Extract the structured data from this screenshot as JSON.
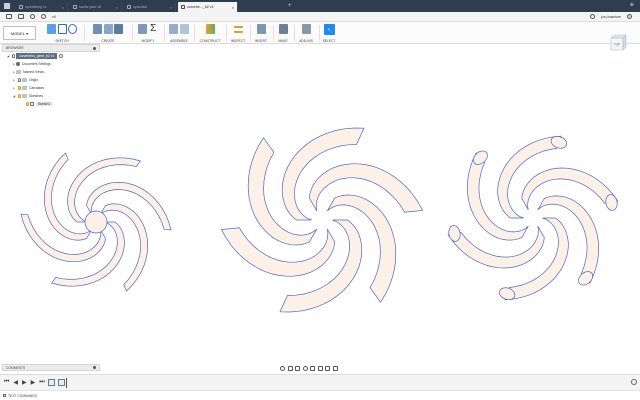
{
  "window": {
    "tabs": [
      {
        "label": "cycoidbing v1",
        "active": false
      },
      {
        "label": "savior.yuto v8",
        "active": false
      },
      {
        "label": "cycloidal",
        "active": false
      },
      {
        "label": "curvehe..._b2 v1",
        "active": true
      }
    ],
    "user": "jon.trawtom",
    "help": "?"
  },
  "quickbar": {
    "doc_label": "e8"
  },
  "ribbon": {
    "mode": "MODEL",
    "groups": [
      "SKETCH",
      "CREATE",
      "MODIFY",
      "ASSEMBLE",
      "CONSTRUCT",
      "INSPECT",
      "INSERT",
      "MAKE",
      "ADD-INS",
      "SELECT"
    ]
  },
  "browser": {
    "title": "BROWSER",
    "root": "curveheho_gene_b2 v1",
    "items": [
      "Document Settings",
      "Named Views",
      "Origin",
      "Canvases",
      "Sketches",
      "Sketch1"
    ]
  },
  "viewcube": {
    "label": "TOP"
  },
  "comments": {
    "title": "COMMENTS"
  },
  "statusbar": {
    "text": "TEXT COMMANDS"
  },
  "colors": {
    "sketch_fill": "#fdf0e6",
    "sketch_stroke": "#4a68c9",
    "tabbar": "#2f3d4e",
    "select": "#1f8ceb"
  }
}
